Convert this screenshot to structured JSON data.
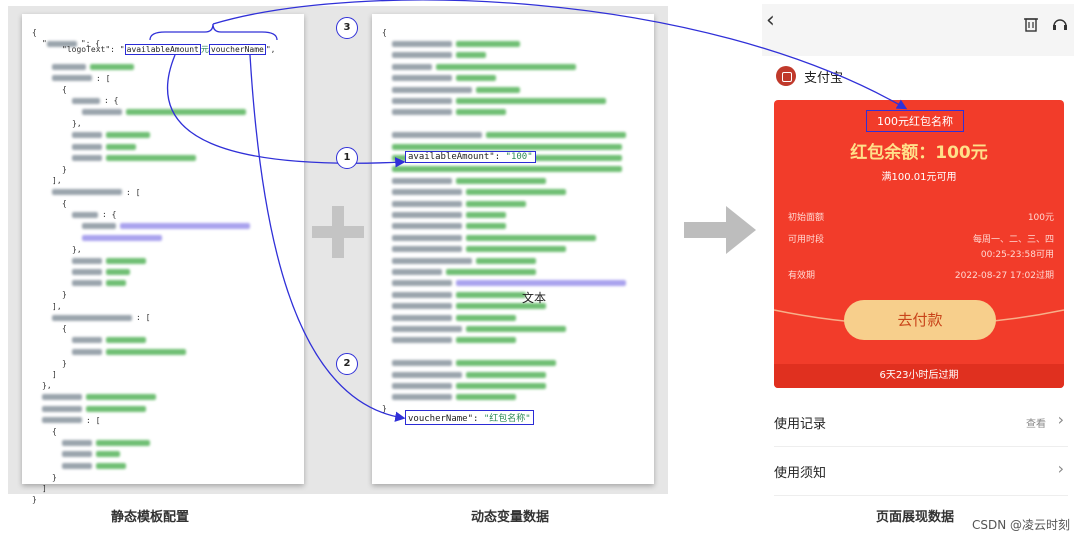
{
  "left_panel": {
    "lines": [
      {
        "ind": 0,
        "t": "{"
      },
      {
        "ind": 1,
        "t": "\"",
        "b": [
          [
            "bk",
            30
          ]
        ],
        "t2": "\": {"
      },
      {
        "ind": 2,
        "t": "\"logoText\": \"",
        "hl": true
      },
      {
        "ind": 2,
        "b": [
          [
            "bk",
            34
          ],
          [
            "gr",
            44
          ]
        ]
      },
      {
        "ind": 2,
        "b": [
          [
            "bk",
            40
          ]
        ],
        "t2": ": ["
      },
      {
        "ind": 3,
        "t": "{"
      },
      {
        "ind": 4,
        "b": [
          [
            "bk",
            28
          ]
        ],
        "t2": ": {"
      },
      {
        "ind": 5,
        "b": [
          [
            "bk",
            40
          ],
          [
            "gr",
            120
          ]
        ]
      },
      {
        "ind": 4,
        "t": "},"
      },
      {
        "ind": 4,
        "b": [
          [
            "bk",
            30
          ],
          [
            "gr",
            44
          ]
        ]
      },
      {
        "ind": 4,
        "b": [
          [
            "bk",
            30
          ],
          [
            "gr",
            30
          ]
        ]
      },
      {
        "ind": 4,
        "b": [
          [
            "bk",
            30
          ],
          [
            "gr",
            90
          ]
        ]
      },
      {
        "ind": 3,
        "t": "}"
      },
      {
        "ind": 2,
        "t": "],"
      },
      {
        "ind": 2,
        "b": [
          [
            "bk",
            70
          ]
        ],
        "t2": ": ["
      },
      {
        "ind": 3,
        "t": "{"
      },
      {
        "ind": 4,
        "b": [
          [
            "bk",
            26
          ]
        ],
        "t2": ": {"
      },
      {
        "ind": 5,
        "b": [
          [
            "bk",
            34
          ],
          [
            "pu",
            130
          ]
        ]
      },
      {
        "ind": 5,
        "b": [
          [
            "pu",
            80
          ]
        ]
      },
      {
        "ind": 4,
        "t": "},"
      },
      {
        "ind": 4,
        "b": [
          [
            "bk",
            30
          ],
          [
            "gr",
            40
          ]
        ]
      },
      {
        "ind": 4,
        "b": [
          [
            "bk",
            30
          ],
          [
            "gr",
            24
          ]
        ]
      },
      {
        "ind": 4,
        "b": [
          [
            "bk",
            30
          ],
          [
            "gr",
            20
          ]
        ]
      },
      {
        "ind": 3,
        "t": "}"
      },
      {
        "ind": 2,
        "t": "],"
      },
      {
        "ind": 2,
        "b": [
          [
            "bk",
            80
          ]
        ],
        "t2": ": ["
      },
      {
        "ind": 3,
        "t": "{"
      },
      {
        "ind": 4,
        "b": [
          [
            "bk",
            30
          ],
          [
            "gr",
            40
          ]
        ]
      },
      {
        "ind": 4,
        "b": [
          [
            "bk",
            30
          ],
          [
            "gr",
            80
          ]
        ]
      },
      {
        "ind": 3,
        "t": "}"
      },
      {
        "ind": 2,
        "t": "]"
      },
      {
        "ind": 1,
        "t": "},"
      },
      {
        "ind": 1,
        "b": [
          [
            "bk",
            40
          ],
          [
            "gr",
            70
          ]
        ]
      },
      {
        "ind": 1,
        "b": [
          [
            "bk",
            40
          ],
          [
            "gr",
            60
          ]
        ]
      },
      {
        "ind": 1,
        "b": [
          [
            "bk",
            40
          ]
        ],
        "t2": ": ["
      },
      {
        "ind": 2,
        "t": "{"
      },
      {
        "ind": 3,
        "b": [
          [
            "bk",
            30
          ],
          [
            "gr",
            54
          ]
        ]
      },
      {
        "ind": 3,
        "b": [
          [
            "bk",
            30
          ],
          [
            "gr",
            24
          ]
        ]
      },
      {
        "ind": 3,
        "b": [
          [
            "bk",
            30
          ],
          [
            "gr",
            30
          ]
        ]
      },
      {
        "ind": 2,
        "t": "}"
      },
      {
        "ind": 1,
        "t": "]"
      },
      {
        "ind": 0,
        "t": "}"
      }
    ],
    "hl_available": "availableAmount",
    "hl_mid": "元",
    "hl_voucher": "voucherName",
    "hl_tail": "\","
  },
  "mid_panel": {
    "lines": [
      {
        "ind": 0,
        "t": "{"
      },
      {
        "ind": 1,
        "b": [
          [
            "bk",
            60
          ],
          [
            "gr",
            64
          ]
        ]
      },
      {
        "ind": 1,
        "b": [
          [
            "bk",
            60
          ],
          [
            "gr",
            30
          ]
        ]
      },
      {
        "ind": 1,
        "b": [
          [
            "bk",
            40
          ],
          [
            "gr",
            140
          ]
        ]
      },
      {
        "ind": 1,
        "b": [
          [
            "bk",
            60
          ],
          [
            "gr",
            40
          ]
        ]
      },
      {
        "ind": 1,
        "b": [
          [
            "bk",
            80
          ],
          [
            "gr",
            44
          ]
        ]
      },
      {
        "ind": 1,
        "b": [
          [
            "bk",
            60
          ],
          [
            "gr",
            150
          ]
        ]
      },
      {
        "ind": 1,
        "b": [
          [
            "bk",
            60
          ],
          [
            "gr",
            50
          ]
        ]
      },
      {
        "ind": 1,
        "hl": "available"
      },
      {
        "ind": 1,
        "b": [
          [
            "bk",
            90
          ],
          [
            "gr",
            140
          ]
        ]
      },
      {
        "ind": 1,
        "b": [
          [
            "gr",
            230
          ]
        ]
      },
      {
        "ind": 1,
        "b": [
          [
            "gr",
            230
          ]
        ]
      },
      {
        "ind": 1,
        "b": [
          [
            "gr",
            230
          ]
        ]
      },
      {
        "ind": 1,
        "b": [
          [
            "bk",
            60
          ],
          [
            "gr",
            90
          ]
        ]
      },
      {
        "ind": 1,
        "b": [
          [
            "bk",
            70
          ],
          [
            "gr",
            100
          ]
        ]
      },
      {
        "ind": 1,
        "b": [
          [
            "bk",
            70
          ],
          [
            "gr",
            60
          ]
        ]
      },
      {
        "ind": 1,
        "b": [
          [
            "bk",
            70
          ],
          [
            "gr",
            40
          ]
        ]
      },
      {
        "ind": 1,
        "b": [
          [
            "bk",
            70
          ],
          [
            "gr",
            40
          ]
        ]
      },
      {
        "ind": 1,
        "b": [
          [
            "bk",
            70
          ],
          [
            "gr",
            130
          ]
        ]
      },
      {
        "ind": 1,
        "b": [
          [
            "bk",
            70
          ],
          [
            "gr",
            100
          ]
        ]
      },
      {
        "ind": 1,
        "b": [
          [
            "bk",
            80
          ],
          [
            "gr",
            60
          ]
        ]
      },
      {
        "ind": 1,
        "b": [
          [
            "bk",
            50
          ],
          [
            "gr",
            90
          ]
        ]
      },
      {
        "ind": 1,
        "b": [
          [
            "bk",
            60
          ],
          [
            "pu",
            170
          ]
        ]
      },
      {
        "ind": 1,
        "b": [
          [
            "bk",
            60
          ],
          [
            "gr",
            70
          ]
        ]
      },
      {
        "ind": 1,
        "b": [
          [
            "bk",
            60
          ],
          [
            "gr",
            90
          ]
        ]
      },
      {
        "ind": 1,
        "b": [
          [
            "bk",
            60
          ],
          [
            "gr",
            60
          ]
        ]
      },
      {
        "ind": 1,
        "b": [
          [
            "bk",
            70
          ],
          [
            "gr",
            100
          ]
        ]
      },
      {
        "ind": 1,
        "b": [
          [
            "bk",
            60
          ],
          [
            "gr",
            60
          ]
        ]
      },
      {
        "ind": 1,
        "hl": "voucher"
      },
      {
        "ind": 1,
        "b": [
          [
            "bk",
            60
          ],
          [
            "gr",
            100
          ]
        ]
      },
      {
        "ind": 1,
        "b": [
          [
            "bk",
            70
          ],
          [
            "gr",
            80
          ]
        ]
      },
      {
        "ind": 1,
        "b": [
          [
            "bk",
            60
          ],
          [
            "gr",
            90
          ]
        ]
      },
      {
        "ind": 1,
        "b": [
          [
            "bk",
            60
          ],
          [
            "gr",
            60
          ]
        ]
      },
      {
        "ind": 0,
        "t": "}"
      }
    ],
    "available_key": "availableAmount",
    "available_val": "\"100\"",
    "voucher_key": "voucherName",
    "voucher_val": "\"红包名称\"",
    "overlay_text": "文本"
  },
  "circles": {
    "one": "1",
    "two": "2",
    "three": "3"
  },
  "captions": {
    "left": "静态模板配置",
    "mid": "动态变量数据",
    "right": "页面展现数据"
  },
  "phone": {
    "back_icon": "chevron-left",
    "trash_icon": "trash",
    "headset_icon": "headset",
    "brand_name": "支付宝",
    "voucher_title": "100元红包名称",
    "balance": "红包余额：100元",
    "condition": "满100.01元可用",
    "rows": [
      {
        "label": "初始面额",
        "value": "100元"
      },
      {
        "label": "可用时段",
        "value": "每周一、二、三、四",
        "value2": "00:25-23:58可用"
      },
      {
        "label": "有效期",
        "value": "2022-08-27 17:02过期"
      }
    ],
    "pay_button": "去付款",
    "expire_note": "6天23小时后过期",
    "usage_record": "使用记录",
    "usage_record_meta": "查看",
    "usage_notice": "使用须知"
  },
  "watermark": "CSDN @凌云时刻",
  "colors": {
    "link": "#3030d8",
    "card_red": "#f23c2a",
    "pay_gold": "#f7cf8c"
  }
}
